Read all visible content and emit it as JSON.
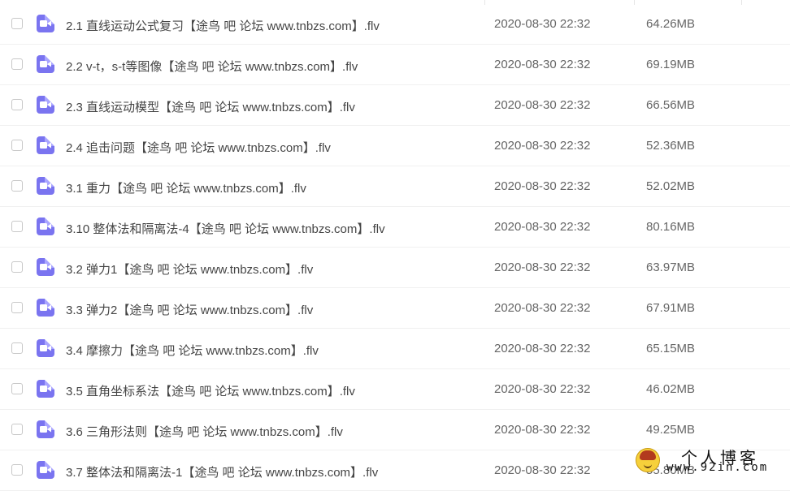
{
  "files": [
    {
      "name": "2.1 直线运动公式复习【途鸟 吧  论坛 www.tnbzs.com】.flv",
      "date": "2020-08-30 22:32",
      "size": "64.26MB"
    },
    {
      "name": "2.2 v-t，s-t等图像【途鸟 吧  论坛 www.tnbzs.com】.flv",
      "date": "2020-08-30 22:32",
      "size": "69.19MB"
    },
    {
      "name": "2.3 直线运动模型【途鸟 吧  论坛 www.tnbzs.com】.flv",
      "date": "2020-08-30 22:32",
      "size": "66.56MB"
    },
    {
      "name": "2.4 追击问题【途鸟 吧  论坛 www.tnbzs.com】.flv",
      "date": "2020-08-30 22:32",
      "size": "52.36MB"
    },
    {
      "name": "3.1 重力【途鸟 吧  论坛 www.tnbzs.com】.flv",
      "date": "2020-08-30 22:32",
      "size": "52.02MB"
    },
    {
      "name": "3.10 整体法和隔离法-4【途鸟 吧  论坛 www.tnbzs.com】.flv",
      "date": "2020-08-30 22:32",
      "size": "80.16MB"
    },
    {
      "name": "3.2 弹力1【途鸟 吧  论坛 www.tnbzs.com】.flv",
      "date": "2020-08-30 22:32",
      "size": "63.97MB"
    },
    {
      "name": "3.3 弹力2【途鸟 吧  论坛 www.tnbzs.com】.flv",
      "date": "2020-08-30 22:32",
      "size": "67.91MB"
    },
    {
      "name": "3.4 摩擦力【途鸟 吧  论坛 www.tnbzs.com】.flv",
      "date": "2020-08-30 22:32",
      "size": "65.15MB"
    },
    {
      "name": "3.5 直角坐标系法【途鸟 吧  论坛 www.tnbzs.com】.flv",
      "date": "2020-08-30 22:32",
      "size": "46.02MB"
    },
    {
      "name": "3.6 三角形法则【途鸟 吧  论坛 www.tnbzs.com】.flv",
      "date": "2020-08-30 22:32",
      "size": "49.25MB"
    },
    {
      "name": "3.7 整体法和隔离法-1【途鸟 吧  论坛 www.tnbzs.com】.flv",
      "date": "2020-08-30 22:32",
      "size": "55.80MB"
    }
  ],
  "file_icon": "video-file-icon",
  "icon_color": "#7a74f0",
  "watermark": {
    "title": "个人博客",
    "url": "www.92in.com"
  }
}
